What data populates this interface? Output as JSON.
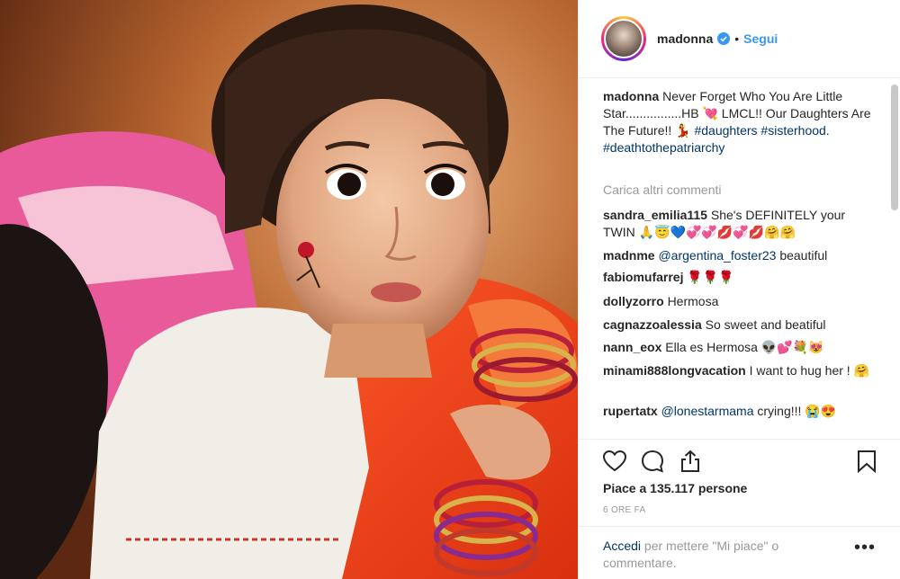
{
  "post": {
    "username": "madonna",
    "separator": "•",
    "follow_label": "Segui",
    "caption_text": "Never Forget Who You Are Little Star................HB 💘 LMCL!! Our Daughters Are The Future!! 💃",
    "hashtags": [
      "#daughters",
      "#sisterhood.",
      "#deathtothepatriarchy"
    ],
    "load_more_label": "Carica altri commenti",
    "likes_label": "Piace a 135.117 persone",
    "time_label": "6 ORE FA",
    "login_link": "Accedi",
    "login_rest": "per mettere \"Mi piace\" o commentare.",
    "more_label": "•••"
  },
  "comments": [
    {
      "user": "sandra_emilia115",
      "text": "She's DEFINITELY your TWIN 🙏😇💙💞💞💋💞💋🤗🤗"
    },
    {
      "user": "madnme",
      "mention": "@argentina_foster23",
      "text": "beautiful"
    },
    {
      "user": "fabiomufarrej",
      "text": "🌹🌹🌹"
    },
    {
      "user": "dollyzorro",
      "text": "Hermosa"
    },
    {
      "user": "cagnazzoalessia",
      "text": "So sweet and beatiful"
    },
    {
      "user": "nann_eox",
      "text": "Ella es Hermosa 👽💕💐😻"
    },
    {
      "user": "minami888longvacation",
      "text": "I want to hug her ! 🤗"
    },
    {
      "user": "rupertatx",
      "mention": "@lonestarmama",
      "text": "crying!!! 😭😍"
    }
  ],
  "icons": {
    "like": "heart-icon",
    "comment": "comment-icon",
    "share": "share-icon",
    "save": "bookmark-icon",
    "verified": "verified-badge-icon"
  },
  "colors": {
    "accent": "#3897f0",
    "link": "#003569",
    "muted": "#999999",
    "text": "#262626"
  }
}
